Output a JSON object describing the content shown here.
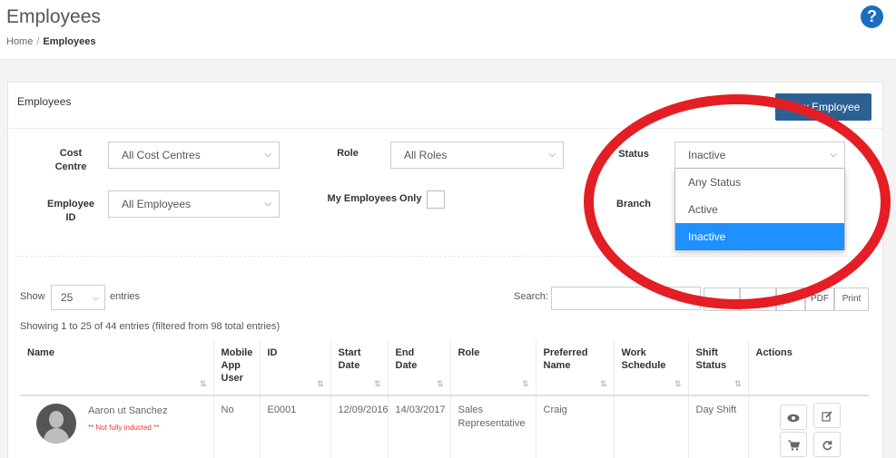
{
  "header": {
    "title": "Employees",
    "breadcrumb": {
      "home": "Home",
      "separator": "/",
      "current": "Employees"
    },
    "help_icon": "question-circle-icon",
    "help_symbol": "?"
  },
  "panel": {
    "title": "Employees",
    "new_button": "New Employee"
  },
  "filters": {
    "cost_centre": {
      "label_line1": "Cost",
      "label_line2": "Centre",
      "value": "All Cost Centres"
    },
    "role": {
      "label": "Role",
      "value": "All Roles"
    },
    "status": {
      "label": "Status",
      "value": "Inactive",
      "options": [
        "Any Status",
        "Active",
        "Inactive"
      ]
    },
    "employee_id": {
      "label_line1": "Employee",
      "label_line2": "ID",
      "value": "All Employees"
    },
    "my_employees_only": {
      "label": "My Employees Only",
      "checked": false
    },
    "branch": {
      "label": "Branch"
    }
  },
  "table_controls": {
    "show_label": "Show",
    "page_size": "25",
    "entries_label": "entries",
    "search_label": "Search:",
    "export_buttons": [
      "PDF",
      "Print"
    ],
    "info": "Showing 1 to 25 of 44 entries (filtered from 98 total entries)"
  },
  "table": {
    "headers": [
      [
        "Name"
      ],
      [
        "Mobile",
        "App",
        "User"
      ],
      [
        "ID"
      ],
      [
        "Start",
        "Date"
      ],
      [
        "End",
        "Date"
      ],
      [
        "Role"
      ],
      [
        "Preferred",
        "Name"
      ],
      [
        "Work",
        "Schedule"
      ],
      [
        "Shift",
        "Status"
      ],
      [
        "Actions"
      ]
    ],
    "rows": [
      {
        "name": "Aaron ut Sanchez",
        "warning": "** Not fully inducted **",
        "mobile_app_user": "No",
        "id": "E0001",
        "start_date": "12/09/2016",
        "end_date": "14/03/2017",
        "role": "Sales Representative",
        "preferred_name": "Craig",
        "work_schedule": "",
        "shift_status": "Day Shift",
        "actions": [
          "eye-icon",
          "edit-icon",
          "cart-icon",
          "refresh-icon"
        ]
      }
    ]
  },
  "annotation": {
    "shape": "ellipse",
    "color": "#e41e24"
  },
  "colors": {
    "primary_button": "#2d6092",
    "selected_option": "#1e90ff",
    "help_icon": "#1a6ec0",
    "warning_text": "#e53935"
  }
}
